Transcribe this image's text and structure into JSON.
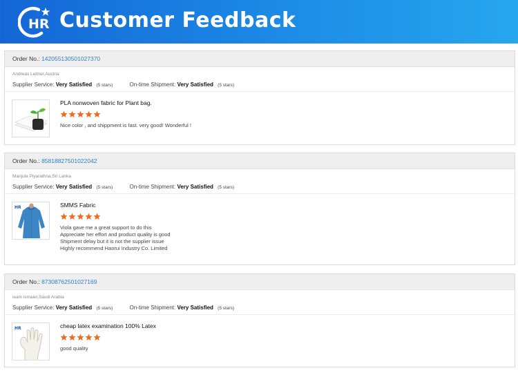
{
  "header": {
    "logo_text": "HR",
    "title": "Customer Feedback"
  },
  "labels": {
    "order_no": "Order No.:",
    "supplier_service": "Supplier Service:",
    "shipment": "On-time Shipment:"
  },
  "colors": {
    "header_start": "#1466d6",
    "header_end": "#27a6ee",
    "star": "#f06a1d",
    "order_link": "#2f7fc0"
  },
  "reviews": [
    {
      "order_no": "142055130501027370",
      "buyer": "Andreas Leitner,Austria",
      "supplier_service": "Very Satisfied",
      "supplier_stars": "(5 stars)",
      "shipment": "Very Satisfied",
      "shipment_stars": "(5 stars)",
      "product": "PLA nonwoven fabric for Plant bag.",
      "rating": 5,
      "thumb_icon": "plant-bag-icon",
      "comment_lines": [
        "Nice color , and shippment is fast. very good! Wonderful !"
      ]
    },
    {
      "order_no": "85818827501022042",
      "buyer": "Manjula Piyarathna,Sri Lanka",
      "supplier_service": "Very Satisfied",
      "supplier_stars": "(5 stars)",
      "shipment": "Very Satisfied",
      "shipment_stars": "(5 stars)",
      "product": "SMMS Fabric",
      "rating": 5,
      "thumb_icon": "surgical-gown-icon",
      "comment_lines": [
        "Viola gave me a great support to do this",
        "Appreciate her effort and product quality is good",
        "Shipment delay but it is not the supplier issue",
        "Highly recommend Haorui Industry Co. Limited"
      ]
    },
    {
      "order_no": "87308762501027169",
      "buyer": "ieam ismaiel,Saudi Arabia",
      "supplier_service": "Very Satisfied",
      "supplier_stars": "(5 stars)",
      "shipment": "Very Satisfied",
      "shipment_stars": "(5 stars)",
      "product": "cheap latex examination 100% Latex",
      "rating": 5,
      "thumb_icon": "latex-glove-icon",
      "comment_lines": [
        "good quality"
      ]
    }
  ]
}
